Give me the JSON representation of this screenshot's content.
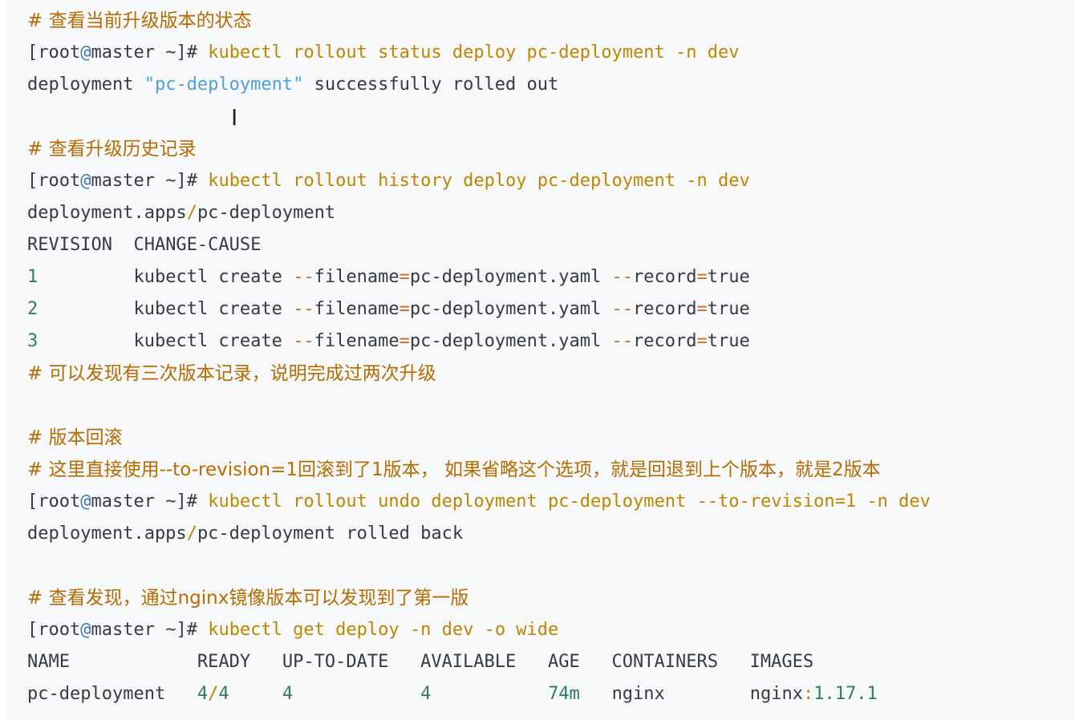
{
  "colors": {
    "background": "#f6f8f9",
    "comment": "#b76b01",
    "command": "#c18401",
    "string": "#4fa0d8",
    "number": "#2e7d5b",
    "at": "#4078c0",
    "text": "#383a42"
  },
  "prompt": {
    "open": "[",
    "user": "root",
    "at": "@",
    "host": "master",
    "close": " ~]#"
  },
  "lines": {
    "c1": "# 查看当前升级版本的状态",
    "cmd1": " kubectl rollout status deploy pc-deployment -n dev",
    "out1_a": "deployment ",
    "out1_str": "\"pc-deployment\"",
    "out1_b": " successfully rolled out",
    "c2": "# 查看升级历史记录",
    "cmd2": " kubectl rollout history deploy pc-deployment -n dev",
    "out2_a": "deployment.apps",
    "out2_slash": "/",
    "out2_b": "pc-deployment",
    "hdr_revision": "REVISION  ",
    "hdr_cause": "CHANGE-CAUSE",
    "rev_rows": [
      {
        "num": "1",
        "pad": "         ",
        "a": "kubectl create ",
        "dash": "--",
        "b": "filename",
        "eq": "=",
        "c": "pc-deployment.yaml ",
        "dash2": "--",
        "d": "record",
        "eq2": "=",
        "e": "true"
      },
      {
        "num": "2",
        "pad": "         ",
        "a": "kubectl create ",
        "dash": "--",
        "b": "filename",
        "eq": "=",
        "c": "pc-deployment.yaml ",
        "dash2": "--",
        "d": "record",
        "eq2": "=",
        "e": "true"
      },
      {
        "num": "3",
        "pad": "         ",
        "a": "kubectl create ",
        "dash": "--",
        "b": "filename",
        "eq": "=",
        "c": "pc-deployment.yaml ",
        "dash2": "--",
        "d": "record",
        "eq2": "=",
        "e": "true"
      }
    ],
    "c3": "# 可以发现有三次版本记录，说明完成过两次升级",
    "c4": "# 版本回滚",
    "c5": "# 这里直接使用--to-revision=1回滚到了1版本， 如果省略这个选项，就是回退到上个版本，就是2版本",
    "cmd3": " kubectl rollout undo deployment pc-deployment --to-revision=1 -n dev",
    "out3_a": "deployment.apps",
    "out3_slash": "/",
    "out3_b": "pc-deployment rolled back",
    "c6": "# 查看发现，通过nginx镜像版本可以发现到了第一版",
    "cmd4": " kubectl get deploy -n dev -o wide",
    "tbl_header": "NAME            READY   UP-TO-DATE   AVAILABLE   AGE   CONTAINERS   IMAGES",
    "tbl_name": "pc-deployment   ",
    "tbl_ready_a": "4",
    "tbl_ready_slash": "/",
    "tbl_ready_b": "4",
    "tbl_gap1": "     ",
    "tbl_uptodate": "4",
    "tbl_gap2": "            ",
    "tbl_available": "4",
    "tbl_gap3": "           ",
    "tbl_age": "74m",
    "tbl_gap4": "   ",
    "tbl_containers": "nginx",
    "tbl_gap5": "        ",
    "tbl_image_a": "nginx",
    "tbl_image_colon": ":",
    "tbl_image_b": "1.17.1"
  },
  "cursor_glyph": "I"
}
